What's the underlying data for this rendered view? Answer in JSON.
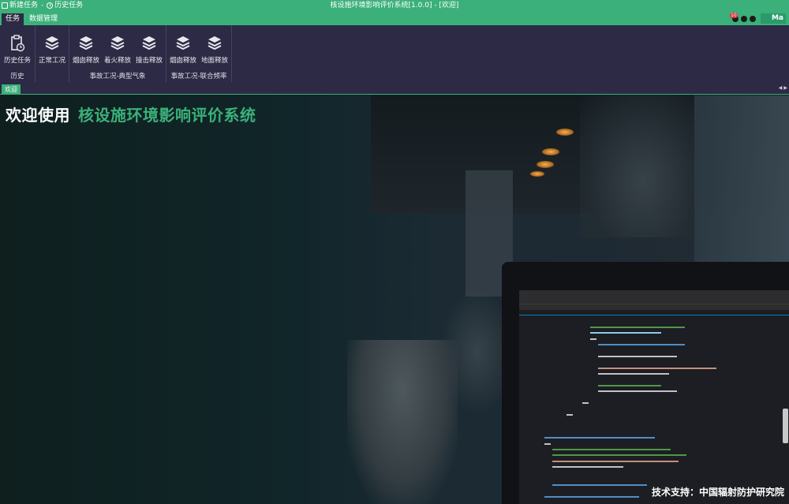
{
  "window": {
    "title": "核设施环境影响评价系统[1.0.0] - [欢迎]",
    "quick_access": [
      {
        "label": "新建任务",
        "icon": "new-task-icon"
      },
      {
        "label": "历史任务",
        "icon": "history-clock-icon"
      }
    ],
    "quick_access_separator": "-"
  },
  "ribbon_tabs": [
    {
      "label": "任务",
      "active": true
    },
    {
      "label": "数据管理",
      "active": false
    }
  ],
  "status": {
    "notification_count": "10",
    "user_label": "Ma"
  },
  "ribbon": {
    "groups": [
      {
        "label": "历史",
        "buttons": [
          {
            "label": "历史任务",
            "icon": "clipboard-clock-icon"
          }
        ]
      },
      {
        "label": "",
        "buttons": [
          {
            "label": "正常工况",
            "icon": "layers-icon"
          }
        ]
      },
      {
        "label": "事故工况-典型气象",
        "buttons": [
          {
            "label": "烟囱释放",
            "icon": "layers-icon"
          },
          {
            "label": "着火释放",
            "icon": "layers-icon"
          },
          {
            "label": "撞击释放",
            "icon": "layers-icon"
          }
        ]
      },
      {
        "label": "事故工况-联合频率",
        "buttons": [
          {
            "label": "烟囱释放",
            "icon": "layers-icon"
          },
          {
            "label": "地面释放",
            "icon": "layers-icon"
          }
        ]
      }
    ]
  },
  "doc_tabs": [
    {
      "label": "欢迎",
      "active": true
    }
  ],
  "welcome": {
    "prefix": "欢迎使用",
    "system_name": "核设施环境影响评价系统",
    "support": "技术支持：中国辐射防护研究院"
  },
  "colors": {
    "accent": "#3bb07a",
    "ribbon_bg": "#2c2a44",
    "content_bg": "#0f2424"
  }
}
